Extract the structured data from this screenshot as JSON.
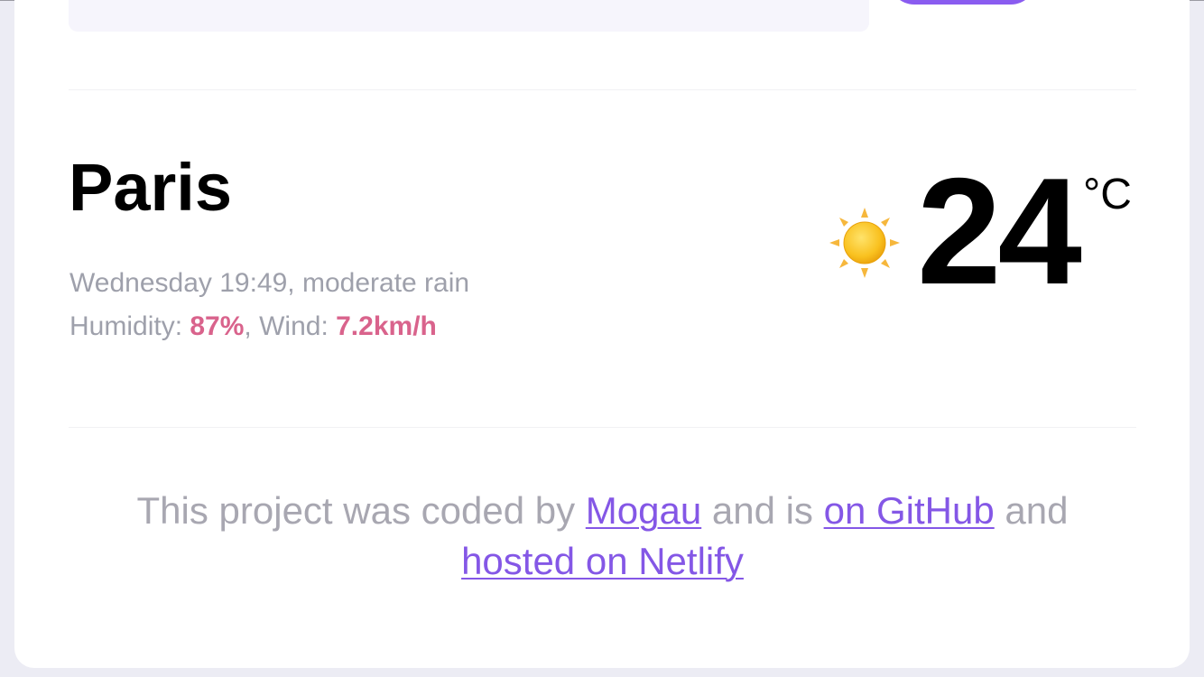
{
  "weather": {
    "city": "Paris",
    "day_time": "Wednesday 19:49",
    "description": "moderate rain",
    "humidity_label": "Humidity:",
    "humidity_value": "87%",
    "wind_label": "Wind:",
    "wind_value": "7.2km/h",
    "temperature": "24",
    "unit": "°C",
    "icon": "sun-icon"
  },
  "footer": {
    "text_1": "This project was coded by",
    "author_link": "Mogau",
    "text_2": "and is",
    "github_link": "on GitHub",
    "text_3": "and",
    "netlify_link": "hosted on Netlify"
  },
  "colors": {
    "accent": "#8457e6",
    "highlight": "#d9638c",
    "muted_text": "#9ea0ab",
    "search_button": "#8a5cf0"
  }
}
